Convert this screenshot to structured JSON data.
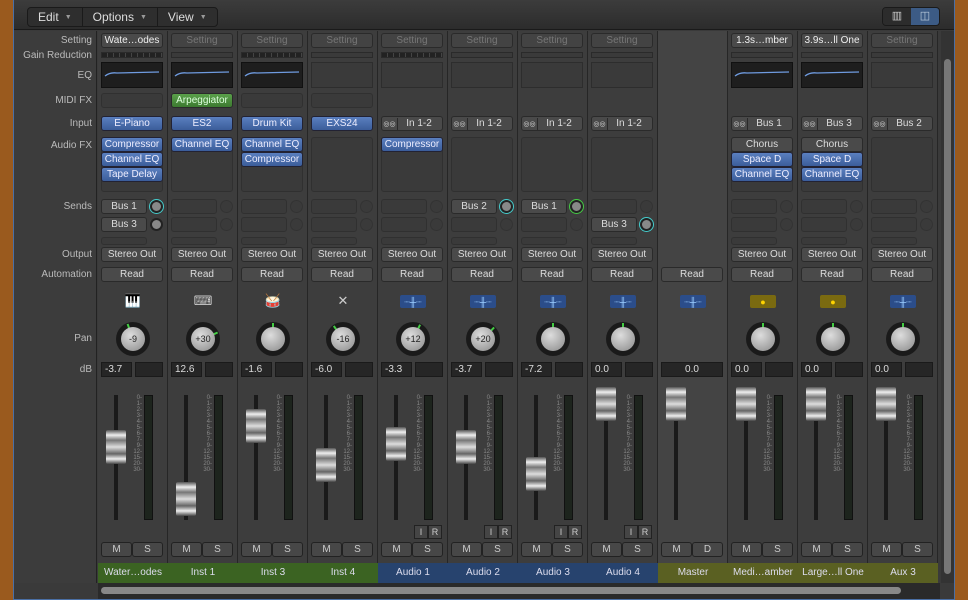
{
  "toolbar": {
    "menus": [
      "Edit",
      "Options",
      "View"
    ],
    "view_buttons": [
      "narrow-strips",
      "wide-strips"
    ]
  },
  "row_labels": [
    "Setting",
    "Gain Reduction",
    "EQ",
    "MIDI FX",
    "Input",
    "Audio FX",
    "Sends",
    "Output",
    "Automation",
    "Pan",
    "dB"
  ],
  "fader_scale": [
    "0",
    "1",
    "2",
    "3",
    "4",
    "5",
    "6",
    "7",
    "9",
    "12",
    "15",
    "20",
    "30"
  ],
  "colors": {
    "instrument": "#3b6322",
    "audio": "#27436e",
    "aux": "#5a6022",
    "selection": "#3c5b85"
  },
  "strips": [
    {
      "setting": "Wate…odes",
      "gain": true,
      "eq": true,
      "midi": "",
      "input": "E-Piano",
      "fx": [
        "Compressor",
        "Channel EQ",
        "Tape Delay"
      ],
      "sends": [
        {
          "label": "Bus 1",
          "c": "on"
        },
        {
          "label": "Bus 3",
          "c": "dark"
        }
      ],
      "output": "Stereo Out",
      "automation": "Read",
      "icon": "piano",
      "pan": "-9",
      "panv": -9,
      "db": "-3.7",
      "name": "Water…odes",
      "type": "instrument",
      "buttons": [
        "M",
        "S"
      ]
    },
    {
      "setting": "Setting",
      "gain": false,
      "eq": true,
      "midi": "Arpeggiator",
      "input": "ES2",
      "fx": [
        "Channel EQ"
      ],
      "sends": [],
      "output": "Stereo Out",
      "automation": "Read",
      "icon": "synth",
      "pan": "+30",
      "panv": 30,
      "db": "12.6",
      "name": "Inst 1",
      "type": "instrument",
      "buttons": [
        "M",
        "S"
      ]
    },
    {
      "setting": "Setting",
      "gain": true,
      "eq": true,
      "midi": "",
      "input": "Drum Kit",
      "fx": [
        "Channel EQ",
        "Compressor"
      ],
      "sends": [],
      "output": "Stereo Out",
      "automation": "Read",
      "icon": "drums",
      "pan": "",
      "panv": 0,
      "db": "-1.6",
      "name": "Inst 3",
      "type": "instrument",
      "buttons": [
        "M",
        "S"
      ]
    },
    {
      "setting": "Setting",
      "gain": false,
      "eq": false,
      "midi": "",
      "input": "EXS24",
      "fx": [],
      "sends": [],
      "output": "Stereo Out",
      "automation": "Read",
      "icon": "keyboard-stand",
      "pan": "-16",
      "panv": -16,
      "db": "-6.0",
      "name": "Inst 4",
      "type": "instrument",
      "buttons": [
        "M",
        "S"
      ]
    },
    {
      "setting": "Setting",
      "gain": true,
      "eq": false,
      "input": "In 1-2",
      "stereo": true,
      "fx": [
        "Compressor"
      ],
      "sends": [],
      "output": "Stereo Out",
      "automation": "Read",
      "icon": "waveform",
      "pan": "+12",
      "panv": 12,
      "db": "-3.3",
      "name": "Audio 1",
      "type": "audio",
      "ir": [
        "I",
        "R"
      ],
      "buttons": [
        "M",
        "S"
      ]
    },
    {
      "setting": "Setting",
      "gain": false,
      "eq": false,
      "input": "In 1-2",
      "stereo": true,
      "fx": [],
      "sends": [
        {
          "label": "Bus 2",
          "c": "on"
        }
      ],
      "output": "Stereo Out",
      "automation": "Read",
      "icon": "waveform",
      "pan": "+20",
      "panv": 20,
      "db": "-3.7",
      "name": "Audio 2",
      "type": "audio",
      "ir": [
        "I",
        "R"
      ],
      "buttons": [
        "M",
        "S"
      ]
    },
    {
      "setting": "Setting",
      "gain": false,
      "eq": false,
      "input": "In 1-2",
      "stereo": true,
      "fx": [],
      "sends": [
        {
          "label": "Bus 1",
          "c": "g"
        }
      ],
      "output": "Stereo Out",
      "automation": "Read",
      "icon": "waveform",
      "pan": "",
      "panv": 0,
      "db": "-7.2",
      "name": "Audio 3",
      "type": "audio",
      "ir": [
        "I",
        "R"
      ],
      "buttons": [
        "M",
        "S"
      ]
    },
    {
      "setting": "Setting",
      "gain": false,
      "eq": false,
      "input": "In 1-2",
      "stereo": true,
      "fx": [],
      "sends": [
        null,
        {
          "label": "Bus 3",
          "c": "on"
        }
      ],
      "output": "Stereo Out",
      "automation": "Read",
      "icon": "waveform",
      "pan": "",
      "panv": 0,
      "db": "0.0",
      "name": "Audio 4",
      "type": "audio",
      "ir": [
        "I",
        "R"
      ],
      "buttons": [
        "M",
        "S"
      ]
    },
    {
      "master": true,
      "automation": "Read",
      "icon": "waveform",
      "db": "0.0",
      "name": "Master",
      "type": "aux",
      "buttons": [
        "M",
        "D"
      ]
    },
    {
      "setting": "1.3s…mber",
      "gain": false,
      "eq": true,
      "input": "Bus 1",
      "stereo": true,
      "fx": [
        "Chorus",
        "Space D",
        "Channel EQ"
      ],
      "sends": [],
      "output": "Stereo Out",
      "automation": "Read",
      "icon": "aux",
      "pan": "",
      "panv": 0,
      "db": "0.0",
      "name": "Medi…amber",
      "type": "aux",
      "buttons": [
        "M",
        "S"
      ]
    },
    {
      "setting": "3.9s…ll One",
      "gain": false,
      "eq": true,
      "input": "Bus 3",
      "stereo": true,
      "fx": [
        "Chorus",
        "Space D",
        "Channel EQ"
      ],
      "sends": [],
      "output": "Stereo Out",
      "automation": "Read",
      "icon": "aux",
      "pan": "",
      "panv": 0,
      "db": "0.0",
      "name": "Large…ll One",
      "type": "aux",
      "buttons": [
        "M",
        "S"
      ]
    },
    {
      "setting": "Setting",
      "gain": false,
      "eq": false,
      "input": "Bus 2",
      "stereo": true,
      "fx": [],
      "sends": [],
      "output": "Stereo Out",
      "automation": "Read",
      "icon": "waveform",
      "pan": "",
      "panv": 0,
      "db": "0.0",
      "name": "Aux 3",
      "type": "aux",
      "buttons": [
        "M",
        "S"
      ]
    }
  ]
}
